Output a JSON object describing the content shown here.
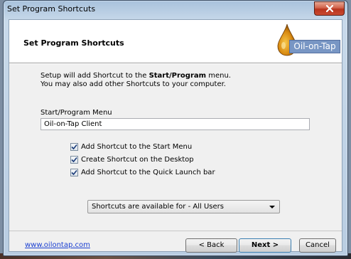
{
  "window": {
    "title": "Set Program Shortcuts"
  },
  "header": {
    "title": "Set Program Shortcuts",
    "logo_text": "Oil-on-Tap"
  },
  "intro": {
    "line1_prefix": "Setup will add Shortcut to the ",
    "line1_bold": "Start/Program",
    "line1_suffix": " menu.",
    "line2": "You may also add other Shortcuts to your computer."
  },
  "start_menu": {
    "label": "Start/Program Menu",
    "value": "Oil-on-Tap Client"
  },
  "options": [
    {
      "label": "Add Shortcut to the Start Menu",
      "checked": true
    },
    {
      "label": "Create Shortcut on the Desktop",
      "checked": true
    },
    {
      "label": "Add Shortcut to the Quick Launch bar",
      "checked": true
    }
  ],
  "scope_select": {
    "selected": "Shortcuts are available for - All Users"
  },
  "footer": {
    "link": "www.oilontap.com",
    "back_label": "< Back",
    "next_label": "Next >",
    "cancel_label": "Cancel"
  },
  "colors": {
    "link": "#1a3fd1",
    "logo_box": "#7896c4",
    "close_button": "#c94a31"
  },
  "icons": {
    "close": "close-icon",
    "logo": "oil-drop-icon",
    "checkbox": "check-icon",
    "dropdown": "chevron-down-icon"
  }
}
